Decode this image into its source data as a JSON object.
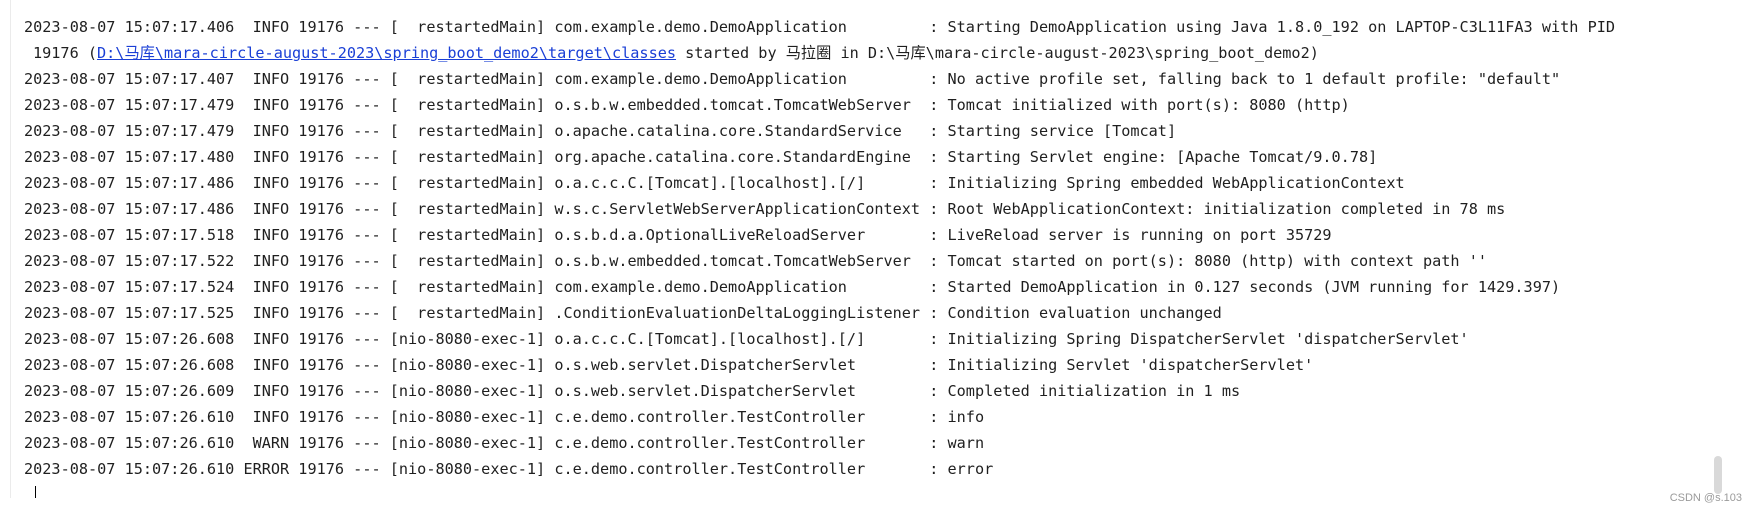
{
  "log": {
    "line1": "2023-08-07 15:07:17.406  INFO 19176 --- [  restartedMain] com.example.demo.DemoApplication         : Starting DemoApplication using Java 1.8.0_192 on LAPTOP-C3L11FA3 with PID",
    "line2_prefix": "19176 (",
    "line2_link": "D:\\马库\\mara-circle-august-2023\\spring_boot_demo2\\target\\classes",
    "line2_suffix": " started by 马拉圈 in D:\\马库\\mara-circle-august-2023\\spring_boot_demo2)",
    "line3": "2023-08-07 15:07:17.407  INFO 19176 --- [  restartedMain] com.example.demo.DemoApplication         : No active profile set, falling back to 1 default profile: \"default\"",
    "line4": "2023-08-07 15:07:17.479  INFO 19176 --- [  restartedMain] o.s.b.w.embedded.tomcat.TomcatWebServer  : Tomcat initialized with port(s): 8080 (http)",
    "line5": "2023-08-07 15:07:17.479  INFO 19176 --- [  restartedMain] o.apache.catalina.core.StandardService   : Starting service [Tomcat]",
    "line6": "2023-08-07 15:07:17.480  INFO 19176 --- [  restartedMain] org.apache.catalina.core.StandardEngine  : Starting Servlet engine: [Apache Tomcat/9.0.78]",
    "line7": "2023-08-07 15:07:17.486  INFO 19176 --- [  restartedMain] o.a.c.c.C.[Tomcat].[localhost].[/]       : Initializing Spring embedded WebApplicationContext",
    "line8": "2023-08-07 15:07:17.486  INFO 19176 --- [  restartedMain] w.s.c.ServletWebServerApplicationContext : Root WebApplicationContext: initialization completed in 78 ms",
    "line9": "2023-08-07 15:07:17.518  INFO 19176 --- [  restartedMain] o.s.b.d.a.OptionalLiveReloadServer       : LiveReload server is running on port 35729",
    "line10": "2023-08-07 15:07:17.522  INFO 19176 --- [  restartedMain] o.s.b.w.embedded.tomcat.TomcatWebServer  : Tomcat started on port(s): 8080 (http) with context path ''",
    "line11": "2023-08-07 15:07:17.524  INFO 19176 --- [  restartedMain] com.example.demo.DemoApplication         : Started DemoApplication in 0.127 seconds (JVM running for 1429.397)",
    "line12": "2023-08-07 15:07:17.525  INFO 19176 --- [  restartedMain] .ConditionEvaluationDeltaLoggingListener : Condition evaluation unchanged",
    "line13": "2023-08-07 15:07:26.608  INFO 19176 --- [nio-8080-exec-1] o.a.c.c.C.[Tomcat].[localhost].[/]       : Initializing Spring DispatcherServlet 'dispatcherServlet'",
    "line14": "2023-08-07 15:07:26.608  INFO 19176 --- [nio-8080-exec-1] o.s.web.servlet.DispatcherServlet        : Initializing Servlet 'dispatcherServlet'",
    "line15": "2023-08-07 15:07:26.609  INFO 19176 --- [nio-8080-exec-1] o.s.web.servlet.DispatcherServlet        : Completed initialization in 1 ms",
    "line16": "2023-08-07 15:07:26.610  INFO 19176 --- [nio-8080-exec-1] c.e.demo.controller.TestController       : info",
    "line17": "2023-08-07 15:07:26.610  WARN 19176 --- [nio-8080-exec-1] c.e.demo.controller.TestController       : warn",
    "line18": "2023-08-07 15:07:26.610 ERROR 19176 --- [nio-8080-exec-1] c.e.demo.controller.TestController       : error"
  },
  "watermark": "CSDN @s.103",
  "colors": {
    "text": "#1f1f1f",
    "link": "#1a3fd6",
    "background": "#ffffff"
  }
}
